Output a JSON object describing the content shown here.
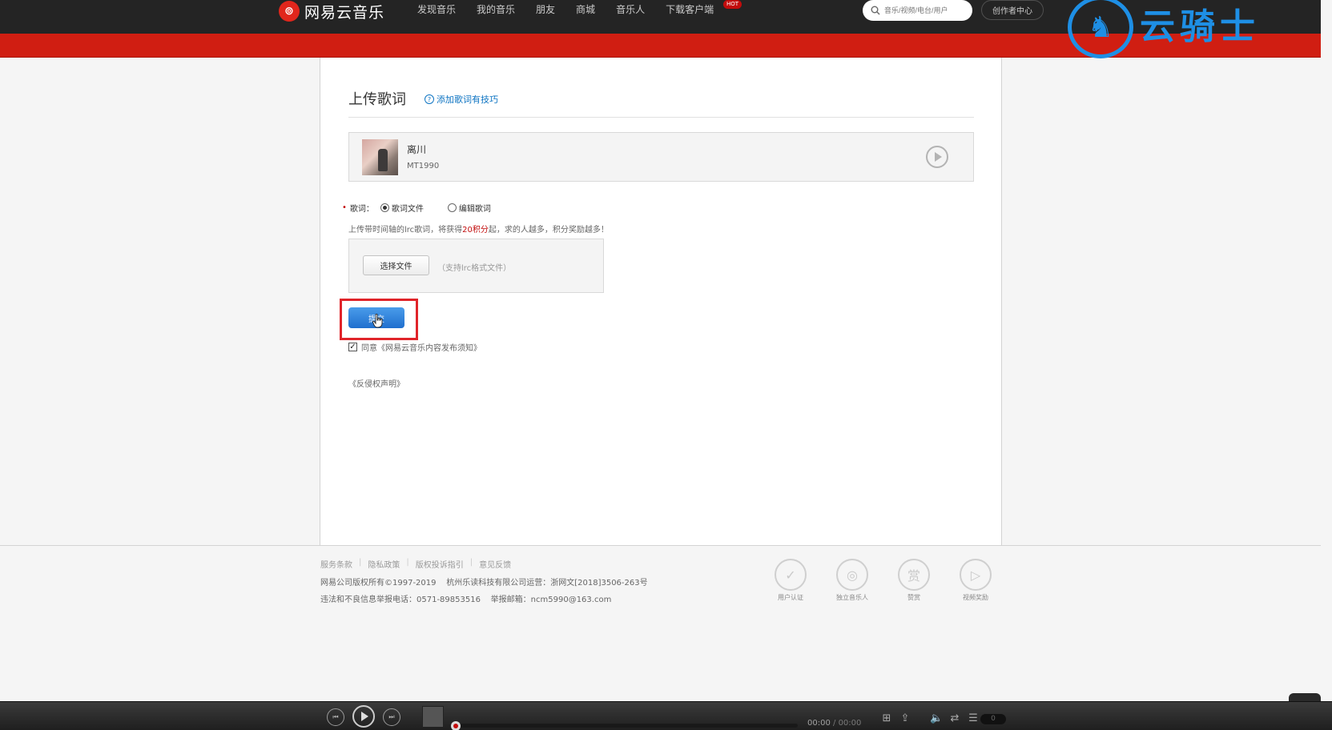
{
  "nav": {
    "logo_text": "网易云音乐",
    "items": [
      "发现音乐",
      "我的音乐",
      "朋友",
      "商城",
      "音乐人",
      "下载客户端"
    ],
    "hot_badge": "HOT",
    "search_placeholder": "音乐/视频/电台/用户",
    "creator_label": "创作者中心"
  },
  "watermark": {
    "text": "云骑士"
  },
  "page": {
    "title": "上传歌词",
    "help_link": "添加歌词有技巧",
    "song": {
      "name": "离川",
      "artist": "MT1990"
    },
    "lyric_label": "歌词：",
    "required_mark": "•",
    "options": {
      "file": "歌词文件",
      "edit": "编辑歌词",
      "selected": "file"
    },
    "tip_before": "上传带时间轴的lrc歌词，将获得",
    "tip_highlight": "20积分",
    "tip_after": "起，求的人越多，积分奖励越多！",
    "choose_file": "选择文件",
    "choose_hint": "（支持lrc格式文件）",
    "submit": "提交",
    "agree_checked": true,
    "agree_text": "同意《网易云音乐内容发布须知》",
    "claim": "《反侵权声明》"
  },
  "footer": {
    "links": [
      "服务条款",
      "隐私政策",
      "版权投诉指引",
      "意见反馈"
    ],
    "separator": "|",
    "copyright": "网易公司版权所有©1997-2019    杭州乐读科技有限公司运营：浙网文[2018]3506-263号",
    "report": "违法和不良信息举报电话：0571-89853516    举报邮箱：ncm5990@163.com",
    "badges": [
      "用户认证",
      "独立音乐人",
      "赞赏",
      "视频奖励"
    ]
  },
  "player": {
    "time_current": "00:00",
    "time_total": "00:00",
    "playlist_count": "0"
  },
  "colors": {
    "brand_red": "#c20c0c",
    "redbar": "#d01e12",
    "link_blue": "#0c73c2",
    "submit_blue": "#2a7fd8",
    "highlight_red": "#e0242a",
    "watermark_blue": "#1e8fe5"
  }
}
